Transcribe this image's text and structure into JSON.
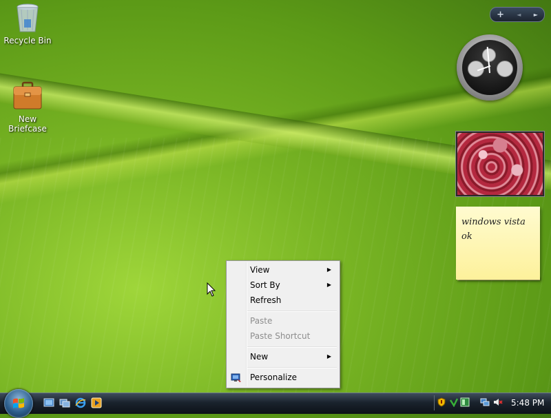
{
  "desktop": {
    "icons": [
      {
        "label": "Recycle Bin"
      },
      {
        "label": "New Briefcase"
      }
    ]
  },
  "sidebar": {
    "add_gadget": "+",
    "prev": "◄",
    "next": "►"
  },
  "note": {
    "line1": "windows vista",
    "line2": "ok"
  },
  "context_menu": {
    "items": [
      {
        "label": "View",
        "submenu": true,
        "enabled": true
      },
      {
        "label": "Sort By",
        "submenu": true,
        "enabled": true
      },
      {
        "label": "Refresh",
        "submenu": false,
        "enabled": true
      },
      {
        "label": "Paste",
        "submenu": false,
        "enabled": false
      },
      {
        "label": "Paste Shortcut",
        "submenu": false,
        "enabled": false
      },
      {
        "label": "New",
        "submenu": true,
        "enabled": true
      },
      {
        "label": "Personalize",
        "submenu": false,
        "enabled": true,
        "icon": "personalize-icon"
      }
    ],
    "submenu_arrow": "▶"
  },
  "taskbar": {
    "time": "5:48 PM"
  }
}
